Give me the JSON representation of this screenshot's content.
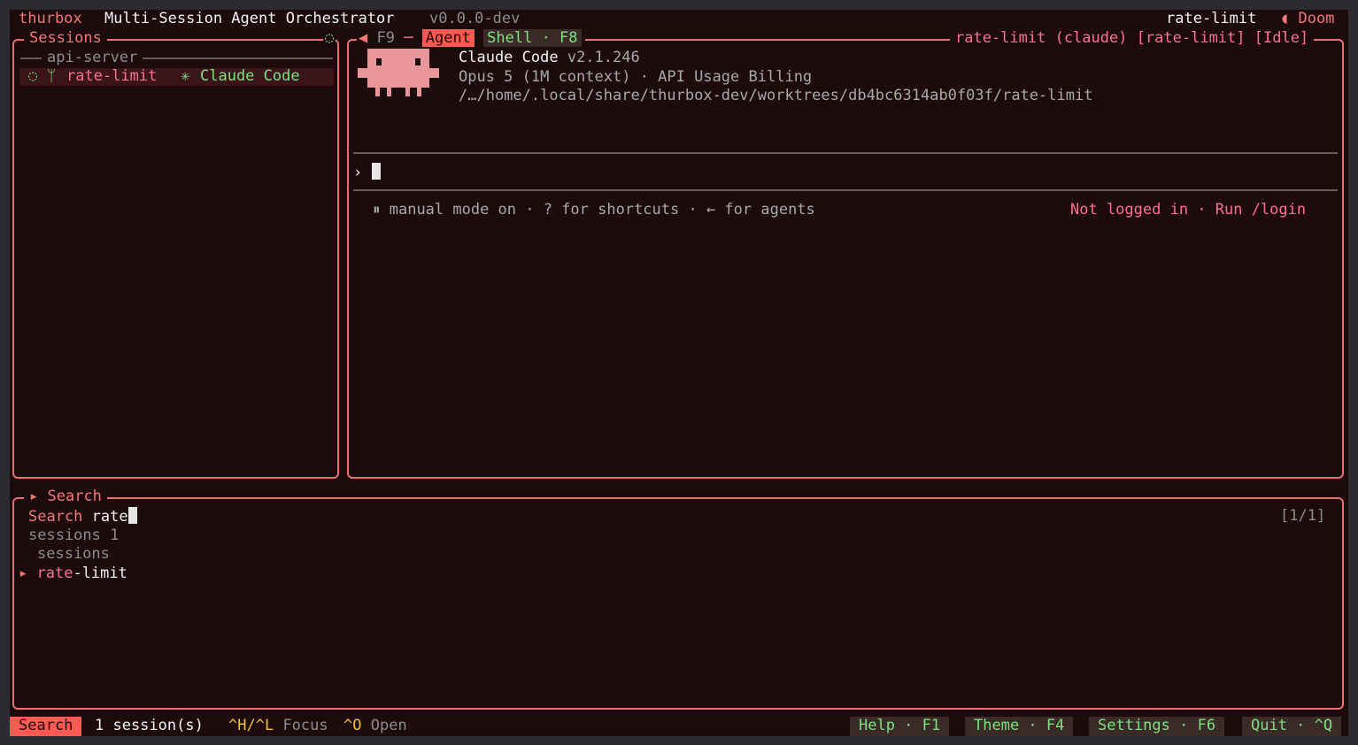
{
  "topbar": {
    "app": "thurbox",
    "title": "Multi-Session Agent Orchestrator",
    "version": "v0.0.0-dev",
    "session": "rate-limit",
    "theme_icon": "◖",
    "theme": "Doom"
  },
  "sessions_panel": {
    "title": "Sessions",
    "spinner": "◌",
    "group": "api-server",
    "item": {
      "status_icon": "◌",
      "branch_icon": "ᛘ",
      "name": "rate-limit",
      "agent_icon": "✳",
      "agent": "Claude Code"
    }
  },
  "agent_panel": {
    "tabs": {
      "left_arrow": "◀",
      "f9": "F9",
      "agent": "Agent",
      "shell": "Shell · F8"
    },
    "status_title": "rate-limit (claude) [rate-limit] [Idle]",
    "header": {
      "product": "Claude Code",
      "version": "v2.1.246",
      "model": "Opus 5 (1M context) · API Usage Billing",
      "path": "/…/home/.local/share/thurbox-dev/worktrees/db4bc6314ab0f03f/rate-limit"
    },
    "prompt_symbol": "›",
    "hint": "⏸ manual mode on · ? for shortcuts · ← for agents",
    "login_status": "Not logged in · Run /login"
  },
  "search_panel": {
    "title_icon": "▸",
    "title": "Search",
    "label": "Search",
    "query": "rate",
    "counter": "[1/1]",
    "summary": "sessions 1",
    "section": "sessions",
    "result_icon": "▸",
    "result_match": "rate",
    "result_rest": "-limit"
  },
  "statusbar": {
    "mode": "Search",
    "count": "1 session(s)",
    "nav_keys": "^H/^L",
    "nav_label": "Focus",
    "open_key": "^O",
    "open_label": "Open",
    "help": "Help · F1",
    "theme": "Theme · F4",
    "settings": "Settings · F6",
    "quit": "Quit · ^Q"
  },
  "colors": {
    "background": "#1c0a0d",
    "border": "#e86f6f",
    "accent": "#ff5a52",
    "green": "#7fe07f",
    "pink": "#ff6f8f"
  }
}
